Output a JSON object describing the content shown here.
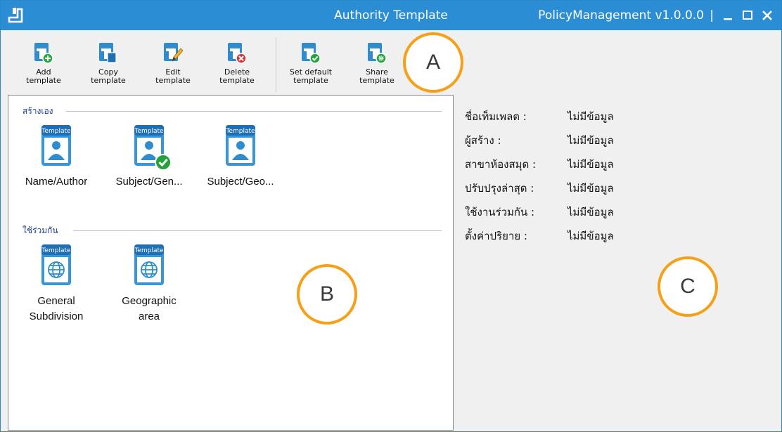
{
  "titlebar": {
    "title": "Authority Template",
    "version": "PolicyManagement v1.0.0.0",
    "separator": "|",
    "buttons": [
      "minimize",
      "maximize",
      "close"
    ]
  },
  "toolbar": {
    "buttons": [
      {
        "label": "Add template",
        "icon": "add-template-icon"
      },
      {
        "label": "Copy template",
        "icon": "copy-template-icon"
      },
      {
        "label": "Edit template",
        "icon": "edit-template-icon"
      },
      {
        "label": "Delete template",
        "icon": "delete-template-icon"
      },
      {
        "label": "Set default template",
        "icon": "set-default-template-icon"
      },
      {
        "label": "Share template",
        "icon": "share-template-icon"
      }
    ]
  },
  "markers": {
    "a": "A",
    "b": "B",
    "c": "C"
  },
  "templates": {
    "own": {
      "title": "สร้างเอง",
      "items": [
        {
          "label": "Name/Author",
          "badge": "Template",
          "icon": "person",
          "is_default": false
        },
        {
          "label": "Subject/Gen...",
          "badge": "Template",
          "icon": "person",
          "is_default": true
        },
        {
          "label": "Subject/Geo...",
          "badge": "Template",
          "icon": "person",
          "is_default": false
        }
      ]
    },
    "shared": {
      "title": "ใช้ร่วมกัน",
      "items": [
        {
          "line1": "General",
          "line2": "Subdivision",
          "badge": "Template",
          "icon": "globe"
        },
        {
          "line1": "Geographic",
          "line2": "area",
          "badge": "Template",
          "icon": "globe"
        }
      ]
    }
  },
  "details": {
    "rows": [
      {
        "key": "ชื่อเท็มเพลต :",
        "value": "ไม่มีข้อมูล"
      },
      {
        "key": "ผู้สร้าง :",
        "value": "ไม่มีข้อมูล"
      },
      {
        "key": "สาขาห้องสมุด :",
        "value": "ไม่มีข้อมูล"
      },
      {
        "key": "ปรับปรุงล่าสุด :",
        "value": "ไม่มีข้อมูล"
      },
      {
        "key": "ใช้งานร่วมกัน :",
        "value": "ไม่มีข้อมูล"
      },
      {
        "key": "ตั้งค่าปริยาย :",
        "value": "ไม่มีข้อมูล"
      }
    ]
  },
  "colors": {
    "titlebar": "#2b8ed4",
    "icon_blue": "#2e8ccf",
    "marker_orange": "#f6a018",
    "success_green": "#22a43a",
    "danger_red": "#d9343a",
    "group_title": "#1c3f8c"
  }
}
